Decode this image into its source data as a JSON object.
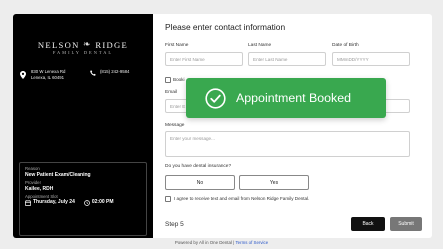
{
  "sidebar": {
    "logo": {
      "name_left": "NELSON",
      "name_right": "RIDGE",
      "subtitle": "FAMILY DENTAL"
    },
    "address_line1": "830 W Lenexa Rd",
    "address_line2": "Lenexa, IL 60491",
    "phone": "(815) 242-9584",
    "summary": {
      "reason_label": "Reason",
      "reason_value": "New Patient Exam/Cleaning",
      "provider_label": "Provider",
      "provider_value": "Kailee, RDH",
      "slot_label": "Appointment Slot",
      "slot_date": "Thursday, July 24",
      "slot_time": "02:00 PM"
    }
  },
  "form": {
    "title": "Please enter contact information",
    "first_name_label": "First Name",
    "first_name_placeholder": "Enter First Name",
    "last_name_label": "Last Name",
    "last_name_placeholder": "Enter Last Name",
    "dob_label": "Date of Birth",
    "dob_placeholder": "MMmDD/YYYY",
    "booking_for_label": "Booki",
    "email_label": "Email",
    "email_placeholder": "Enter E",
    "message_label": "Message",
    "message_placeholder": "Enter your message...",
    "insurance_question": "Do you have dental insurance?",
    "no_label": "No",
    "yes_label": "Yes",
    "consent_label": "I agree to receive text and email from Nelson Ridge Family Dental.",
    "step_label": "Step 5",
    "back_label": "Back",
    "submit_label": "Submit"
  },
  "toast": {
    "message": "Appointment Booked"
  },
  "footer": {
    "prefix": "Powered by All in One Dental",
    "separator": " | ",
    "link": "Terms of Service"
  },
  "colors": {
    "toast_green": "#39a84f",
    "sidebar_bg": "#000000",
    "link_blue": "#2a57c9",
    "submit_gray": "#777777"
  }
}
